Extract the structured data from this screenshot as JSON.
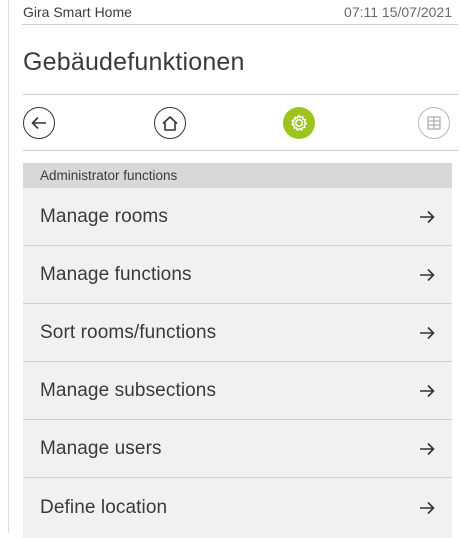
{
  "status": {
    "app_name": "Gira Smart Home",
    "datetime": "07:11 15/07/2021"
  },
  "page": {
    "title": "Gebäudefunktionen"
  },
  "nav": {
    "back_icon": "arrow-left-icon",
    "home_icon": "house-icon",
    "settings_icon": "gear-icon",
    "grid_icon": "grid-icon",
    "active": "settings",
    "accent_color": "#9dc31e"
  },
  "section": {
    "header": "Administrator functions"
  },
  "menu": {
    "items": [
      {
        "label": "Manage rooms"
      },
      {
        "label": "Manage functions"
      },
      {
        "label": "Sort rooms/functions"
      },
      {
        "label": "Manage subsections"
      },
      {
        "label": "Manage users"
      },
      {
        "label": "Define location"
      }
    ]
  }
}
